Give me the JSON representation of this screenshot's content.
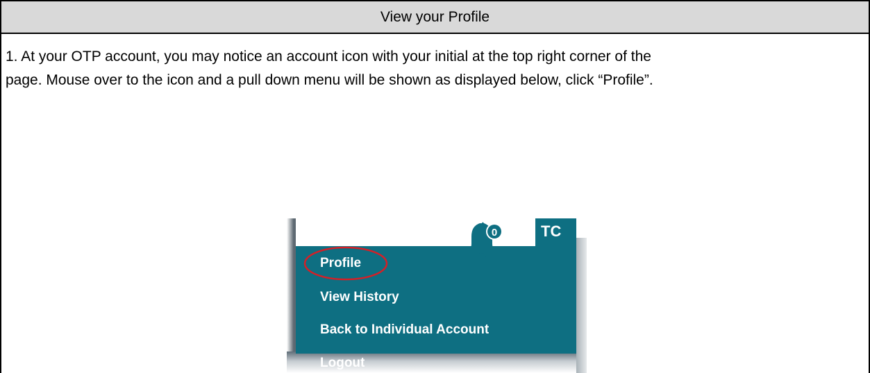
{
  "header": {
    "title": "View your Profile"
  },
  "body": {
    "instruction_line1": "1. At your OTP account, you may notice an account icon with your initial at the top right corner of the",
    "instruction_line2": "page. Mouse over to the icon and a pull down menu will be shown as displayed below, click “Profile”."
  },
  "screenshot": {
    "notification_count": "0",
    "account_initials": "TC",
    "menu_items": [
      {
        "label": "Profile"
      },
      {
        "label": "View History"
      },
      {
        "label": "Back to Individual Account"
      },
      {
        "label": "Logout"
      }
    ],
    "colors": {
      "menu_background": "#0e6f82",
      "highlight_ring": "#d61f26",
      "header_background": "#d9d9d9"
    },
    "icons": {
      "notification": "bell-icon"
    }
  }
}
